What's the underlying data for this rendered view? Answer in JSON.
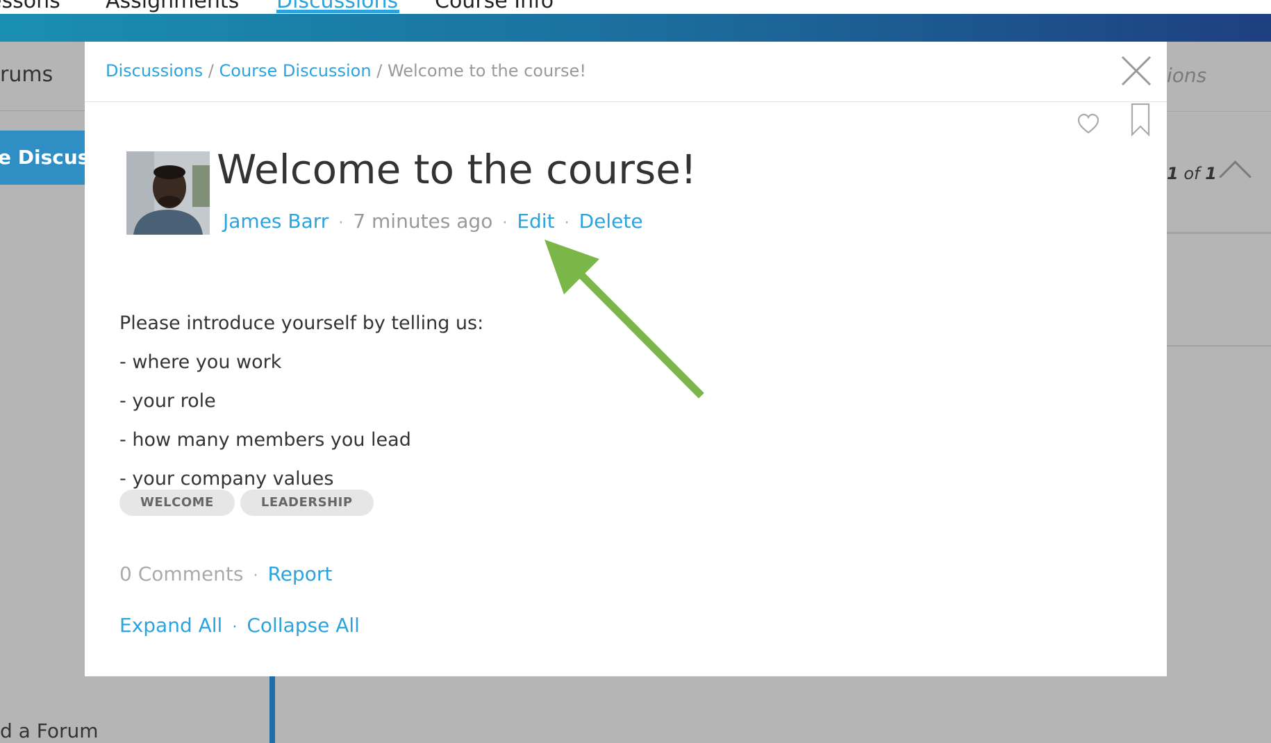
{
  "topnav": {
    "items": [
      "essons",
      "Assignments",
      "Discussions",
      "Course Info"
    ],
    "active_index": 2
  },
  "background": {
    "left_header": "rums",
    "active_tab": "e Discussions",
    "add_forum": "d a Forum",
    "right_header": "ions",
    "pager_current": "1",
    "pager_of": "of",
    "pager_total": "1"
  },
  "modal": {
    "breadcrumb": {
      "items": [
        "Discussions",
        "Course Discussion"
      ],
      "current": "Welcome to the course!",
      "separator": "/"
    },
    "post": {
      "title": "Welcome to the course!",
      "author": "James Barr",
      "time": "7 minutes ago",
      "edit_label": "Edit",
      "delete_label": "Delete",
      "separator": "·",
      "body": [
        "Please introduce yourself by telling us:",
        "- where you work",
        "- your role",
        "- how many members you lead",
        "- your company values"
      ],
      "tags": [
        "WELCOME",
        "LEADERSHIP"
      ],
      "comments": "0 Comments",
      "report_label": "Report",
      "expand_label": "Expand All",
      "collapse_label": "Collapse All"
    }
  },
  "colors": {
    "accent": "#2aa3de",
    "annotation_arrow": "#7ab648",
    "overlay": "#b5b5b5"
  }
}
